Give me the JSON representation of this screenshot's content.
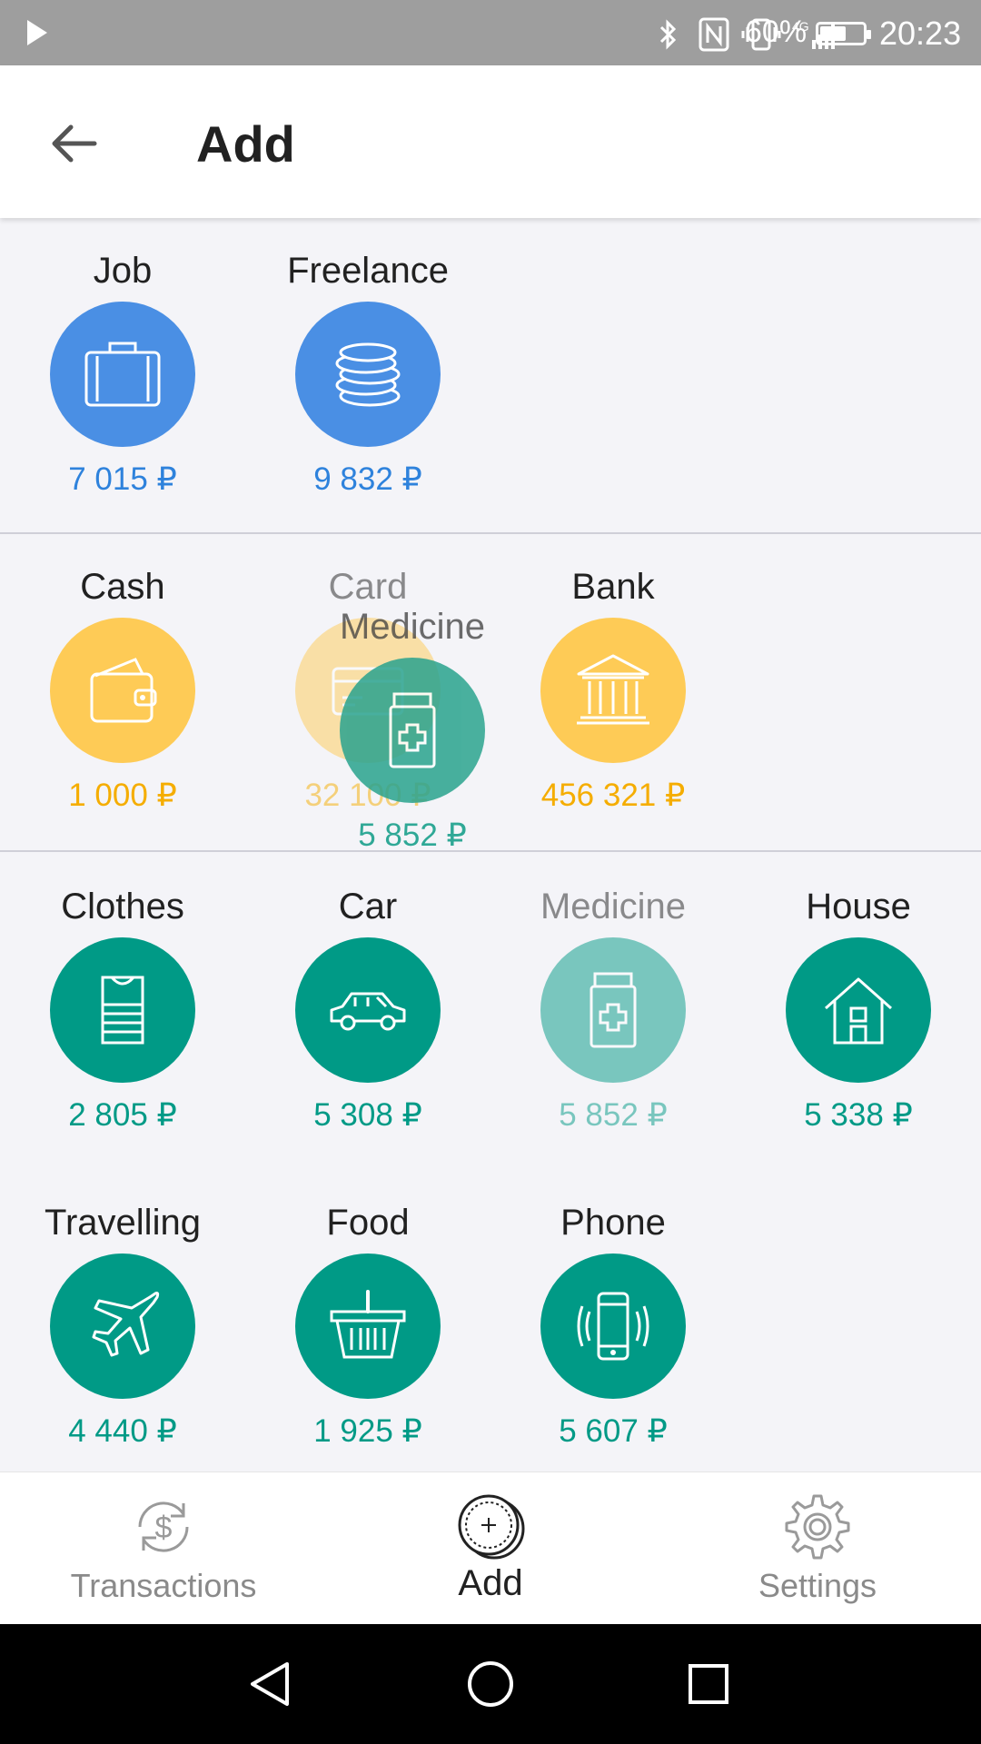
{
  "status_bar": {
    "battery_percent": "60%",
    "battery_level": 0.6,
    "time": "20:23",
    "icons": [
      "play-icon",
      "bluetooth-icon",
      "nfc-icon",
      "vibrate-icon",
      "signal-4g-icon",
      "battery-icon"
    ]
  },
  "app_bar": {
    "title": "Add",
    "back_icon": "back-arrow-icon"
  },
  "sections": {
    "income": {
      "items": [
        {
          "label": "Job",
          "amount": "7 015 ₽",
          "icon": "briefcase-icon",
          "color": "#4a8fe4"
        },
        {
          "label": "Freelance",
          "amount": "9 832 ₽",
          "icon": "coins-icon",
          "color": "#4a8fe4"
        }
      ]
    },
    "accounts": {
      "items": [
        {
          "label": "Cash",
          "amount": "1 000 ₽",
          "icon": "wallet-icon",
          "color": "#fecb56"
        },
        {
          "label": "Card",
          "amount": "32 100 ₽",
          "icon": "credit-card-icon",
          "color": "#fecb56"
        },
        {
          "label": "Bank",
          "amount": "456 321 ₽",
          "icon": "bank-icon",
          "color": "#fecb56"
        }
      ]
    },
    "expenses": {
      "items": [
        {
          "label": "Clothes",
          "amount": "2 805 ₽",
          "icon": "shirt-icon",
          "color": "#009a86"
        },
        {
          "label": "Car",
          "amount": "5 308 ₽",
          "icon": "car-icon",
          "color": "#009a86"
        },
        {
          "label": "Medicine",
          "amount": "5 852 ₽",
          "icon": "medicine-icon",
          "color": "#009a86"
        },
        {
          "label": "House",
          "amount": "5 338 ₽",
          "icon": "house-icon",
          "color": "#009a86"
        },
        {
          "label": "Travelling",
          "amount": "4 440 ₽",
          "icon": "airplane-icon",
          "color": "#009a86"
        },
        {
          "label": "Food",
          "amount": "1 925 ₽",
          "icon": "basket-icon",
          "color": "#009a86"
        },
        {
          "label": "Phone",
          "amount": "5 607 ₽",
          "icon": "phone-icon",
          "color": "#009a86"
        }
      ]
    }
  },
  "drag_overlay": {
    "label": "Medicine",
    "amount": "5 852 ₽",
    "icon": "medicine-icon"
  },
  "bottom_nav": {
    "items": [
      {
        "label": "Transactions",
        "icon": "dollar-refresh-icon"
      },
      {
        "label": "Add",
        "icon": "add-coin-icon"
      },
      {
        "label": "Settings",
        "icon": "gear-icon"
      }
    ],
    "active": "Add"
  },
  "system_nav": {
    "icons": [
      "back-triangle-icon",
      "home-circle-icon",
      "recents-square-icon"
    ]
  }
}
